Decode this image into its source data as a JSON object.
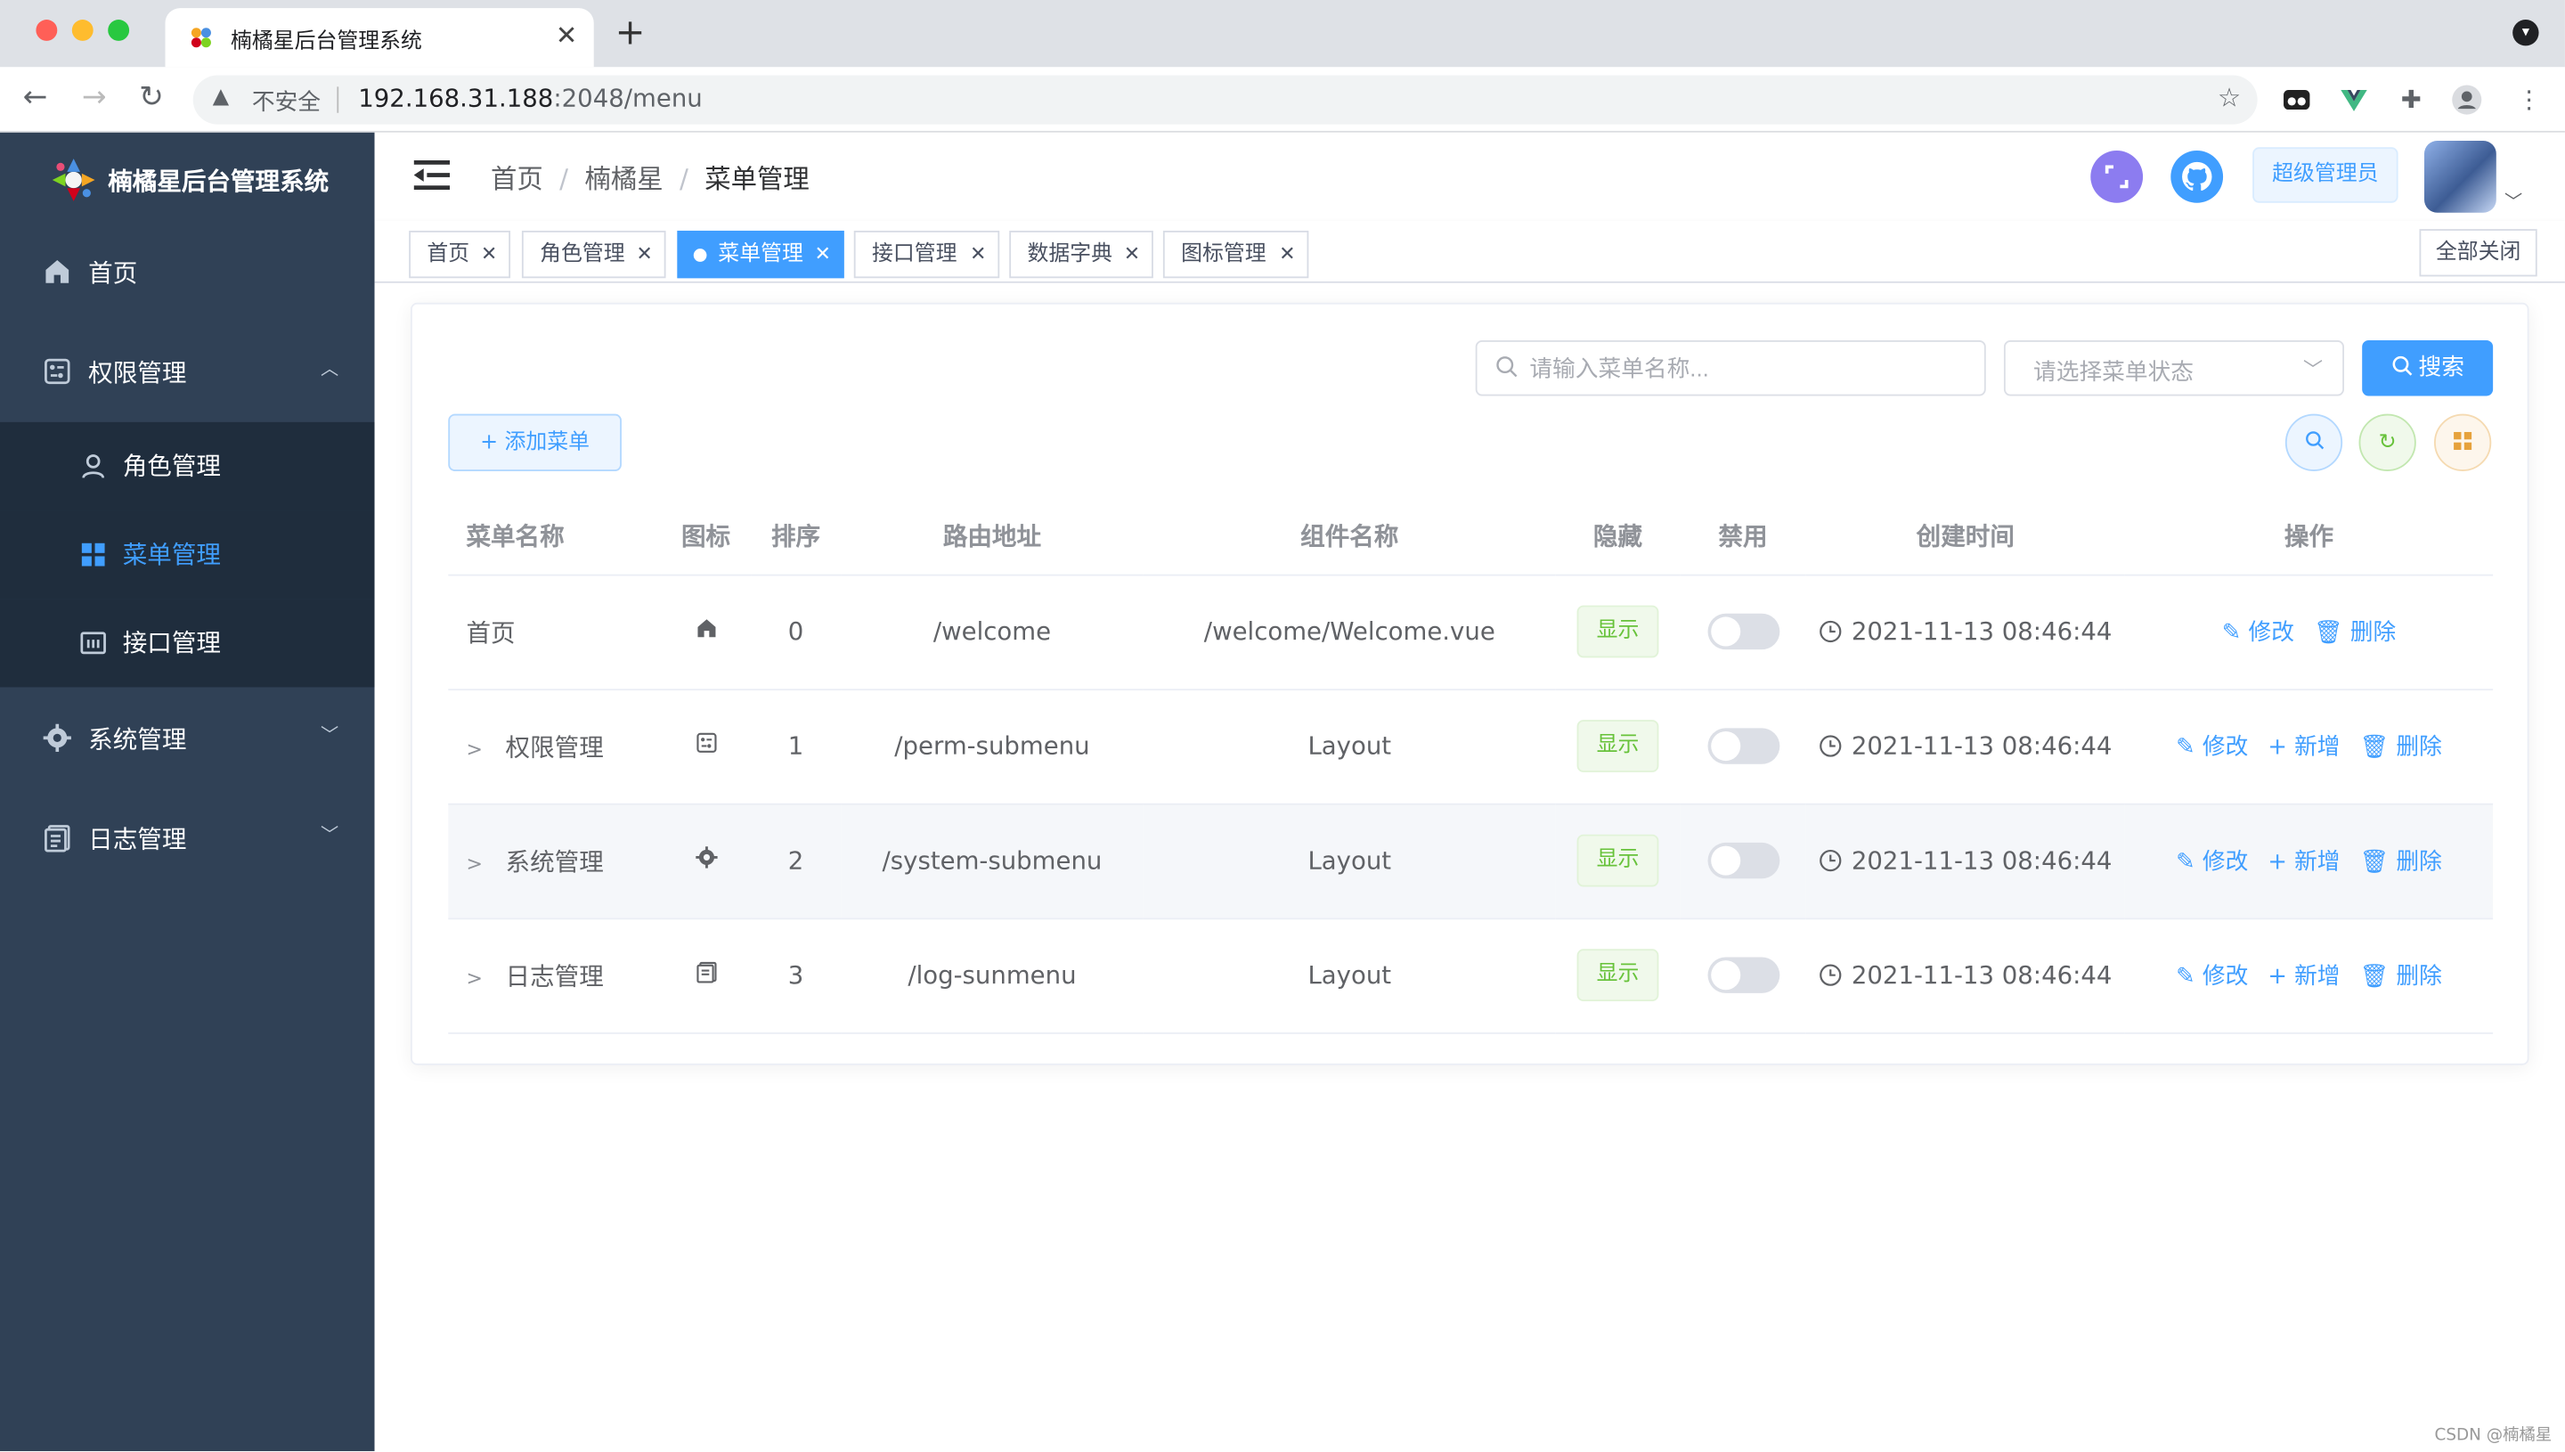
{
  "browser": {
    "tab_title": "楠橘星后台管理系统",
    "tab_close": "✕",
    "new_tab": "+",
    "insecure_label": "不安全",
    "url_host": "192.168.31.188",
    "url_rest": ":2048/menu"
  },
  "sidebar": {
    "app_title": "楠橘星后台管理系统",
    "items": [
      {
        "label": "首页",
        "icon": "home-icon"
      },
      {
        "label": "权限管理",
        "icon": "permission-icon",
        "expanded": true
      },
      {
        "label": "角色管理",
        "icon": "user-icon"
      },
      {
        "label": "菜单管理",
        "icon": "menu-grid-icon",
        "active": true
      },
      {
        "label": "接口管理",
        "icon": "api-icon"
      },
      {
        "label": "系统管理",
        "icon": "gear-icon"
      },
      {
        "label": "日志管理",
        "icon": "document-icon"
      }
    ]
  },
  "header": {
    "breadcrumb": [
      "首页",
      "楠橘星",
      "菜单管理"
    ],
    "admin_label": "超级管理员"
  },
  "tags": {
    "items": [
      "首页",
      "角色管理",
      "菜单管理",
      "接口管理",
      "数据字典",
      "图标管理"
    ],
    "active": "菜单管理",
    "close_all": "全部关闭"
  },
  "toolbar": {
    "search_placeholder": "请输入菜单名称...",
    "status_placeholder": "请选择菜单状态",
    "search_label": "搜索",
    "add_label": "添加菜单"
  },
  "table": {
    "headers": [
      "菜单名称",
      "图标",
      "排序",
      "路由地址",
      "组件名称",
      "隐藏",
      "禁用",
      "创建时间",
      "操作"
    ],
    "rows": [
      {
        "name": "首页",
        "icon": "home-icon",
        "order": "0",
        "path": "/welcome",
        "component": "/welcome/Welcome.vue",
        "hidden": "显示",
        "created": "2021-11-13 08:46:44",
        "has_children": false
      },
      {
        "name": "权限管理",
        "icon": "permission-icon",
        "order": "1",
        "path": "/perm-submenu",
        "component": "Layout",
        "hidden": "显示",
        "created": "2021-11-13 08:46:44",
        "has_children": true
      },
      {
        "name": "系统管理",
        "icon": "gear-icon",
        "order": "2",
        "path": "/system-submenu",
        "component": "Layout",
        "hidden": "显示",
        "created": "2021-11-13 08:46:44",
        "has_children": true
      },
      {
        "name": "日志管理",
        "icon": "document-icon",
        "order": "3",
        "path": "/log-sunmenu",
        "component": "Layout",
        "hidden": "显示",
        "created": "2021-11-13 08:46:44",
        "has_children": true
      }
    ],
    "actions": {
      "edit": "修改",
      "add": "新增",
      "delete": "删除"
    }
  },
  "watermark": "CSDN @楠橘星",
  "colors": {
    "primary": "#409eff",
    "sidebar": "#304156",
    "success": "#67c23a"
  }
}
